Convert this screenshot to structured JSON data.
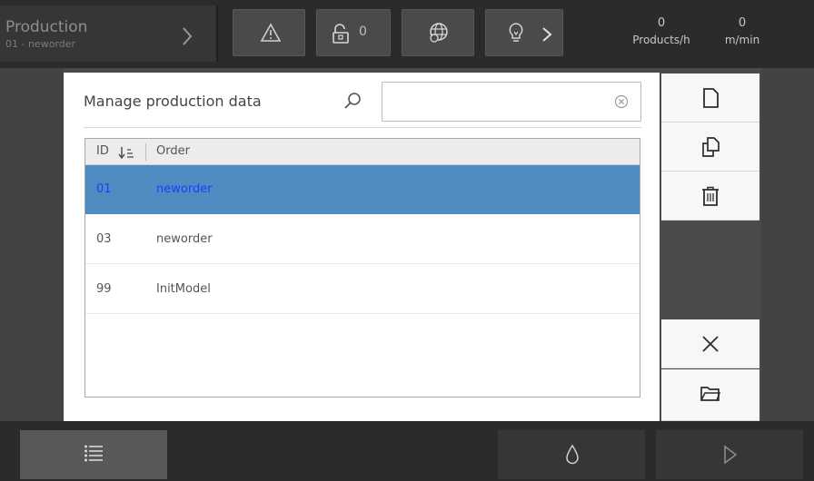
{
  "header": {
    "production_title": "Production",
    "production_subtitle": "01 - neworder",
    "lock_count": "0",
    "readouts": [
      {
        "value": "0",
        "unit": "Products/h"
      },
      {
        "value": "0",
        "unit": "m/min"
      }
    ]
  },
  "dialog": {
    "title": "Manage production data",
    "search": {
      "value": "",
      "placeholder": ""
    },
    "table": {
      "columns": [
        "ID",
        "Order"
      ],
      "rows": [
        {
          "id": "01",
          "order": "neworder",
          "selected": true
        },
        {
          "id": "03",
          "order": "neworder",
          "selected": false
        },
        {
          "id": "99",
          "order": "InitModel",
          "selected": false
        }
      ]
    }
  },
  "sidebar_actions": [
    "new-file-icon",
    "copy-icon",
    "trash-icon",
    "close-icon",
    "folder-open-icon"
  ],
  "colors": {
    "selection": "#4e8cc2",
    "selected_text": "#1f3dff"
  }
}
